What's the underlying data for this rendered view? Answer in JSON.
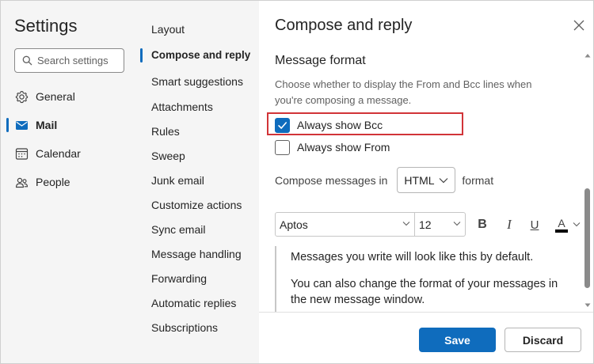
{
  "app": {
    "title": "Settings",
    "search_placeholder": "Search settings"
  },
  "nav": {
    "items": [
      {
        "label": "General",
        "icon": "gear-icon"
      },
      {
        "label": "Mail",
        "icon": "mail-icon",
        "active": true
      },
      {
        "label": "Calendar",
        "icon": "calendar-icon"
      },
      {
        "label": "People",
        "icon": "people-icon"
      }
    ]
  },
  "submenu": {
    "items": [
      {
        "label": "Layout"
      },
      {
        "label": "Compose and reply",
        "active": true
      },
      {
        "label": "Smart suggestions"
      },
      {
        "label": "Attachments"
      },
      {
        "label": "Rules"
      },
      {
        "label": "Sweep"
      },
      {
        "label": "Junk email"
      },
      {
        "label": "Customize actions"
      },
      {
        "label": "Sync email"
      },
      {
        "label": "Message handling"
      },
      {
        "label": "Forwarding"
      },
      {
        "label": "Automatic replies"
      },
      {
        "label": "Subscriptions"
      }
    ]
  },
  "panel": {
    "title": "Compose and reply",
    "section": {
      "heading": "Message format",
      "description": "Choose whether to display the From and Bcc lines when you're composing a message."
    },
    "options": [
      {
        "label": "Always show Bcc",
        "checked": true
      },
      {
        "label": "Always show From",
        "checked": false
      }
    ],
    "compose": {
      "prefix": "Compose messages in",
      "format_value": "HTML",
      "suffix": "format"
    },
    "toolbar": {
      "font": "Aptos",
      "size": "12",
      "bold": "B",
      "italic": "I",
      "underline": "U",
      "font_color": "A"
    },
    "preview": {
      "line1": "Messages you write will look like this by default.",
      "line2": "You can also change the format of your messages in the new message window."
    },
    "buttons": {
      "save": "Save",
      "discard": "Discard"
    }
  },
  "colors": {
    "accent": "#0f6cbd",
    "highlight": "#d13438",
    "sidebar_bg": "#f5f5f5"
  }
}
